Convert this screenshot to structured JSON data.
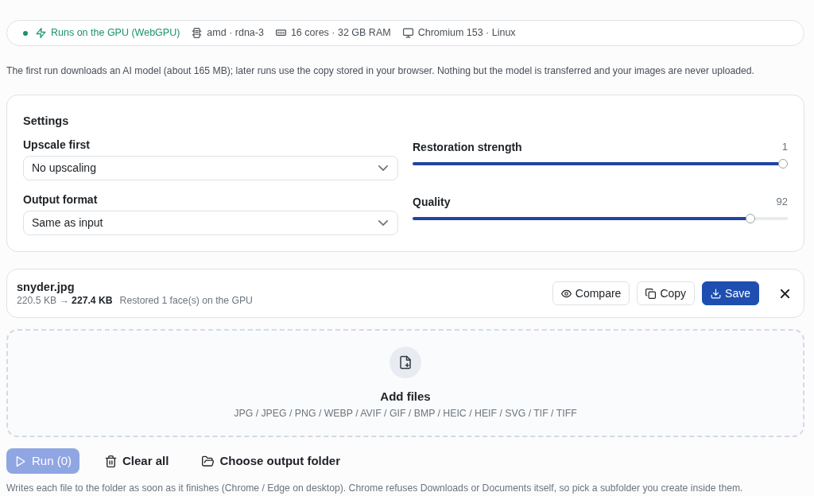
{
  "status_bar": {
    "items": [
      {
        "kind": "runtime",
        "text": "Runs on the GPU (WebGPU)"
      },
      {
        "kind": "gpu",
        "text": "amd · rdna-3"
      },
      {
        "kind": "cpu",
        "text": "16 cores · 32 GB RAM"
      },
      {
        "kind": "browser",
        "text": "Chromium 153 · Linux"
      }
    ]
  },
  "notice": "The first run downloads an AI model (about 165 MB); later runs use the copy stored in your browser. Nothing but the model is transferred and your images are never uploaded.",
  "settings": {
    "title": "Settings",
    "selects": [
      {
        "label": "Upscale first",
        "value": "No upscaling"
      },
      {
        "label": "Output format",
        "value": "Same as input"
      }
    ],
    "sliders": [
      {
        "label": "Restoration strength",
        "reading": "1",
        "level": 1.0
      },
      {
        "label": "Quality",
        "reading": "92",
        "level": 0.91
      }
    ]
  },
  "files": [
    {
      "name": "snyder.jpg",
      "sizes": "220.5 KB → **227.4 KB**",
      "status": "Restored 1 face(s) on the GPU",
      "actions": [
        {
          "kind": "compare",
          "label": "Compare"
        },
        {
          "kind": "copy",
          "label": "Copy"
        },
        {
          "kind": "save",
          "label": "Save"
        }
      ]
    }
  ],
  "dropzone": {
    "title": "Add files",
    "formats": "JPG / JPEG / PNG / WEBP / AVIF / GIF / BMP / HEIC / HEIF / SVG / TIF / TIFF"
  },
  "toolbar": [
    {
      "kind": "run",
      "label": "Run (0)",
      "disabled": true
    },
    {
      "kind": "clear",
      "label": "Clear all",
      "disabled": false
    },
    {
      "kind": "folder",
      "label": "Choose output folder",
      "disabled": false
    }
  ],
  "note": "Writes each file to the folder as soon as it finishes (Chrome / Edge on desktop). Chrome refuses Downloads or Documents itself, so pick a subfolder you create inside them."
}
